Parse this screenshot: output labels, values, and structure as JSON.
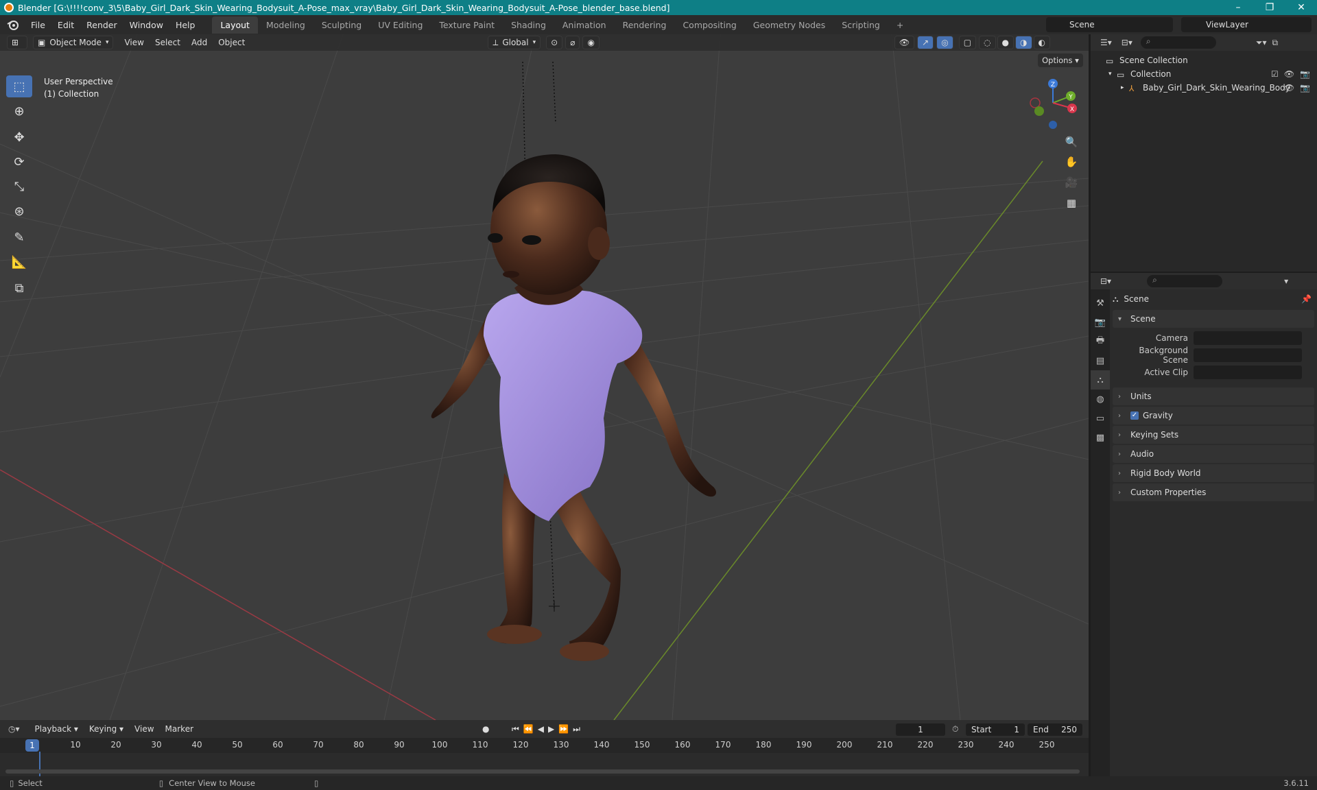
{
  "window": {
    "title": "Blender [G:\\!!!!conv_3\\5\\Baby_Girl_Dark_Skin_Wearing_Bodysuit_A-Pose_max_vray\\Baby_Girl_Dark_Skin_Wearing_Bodysuit_A-Pose_blender_base.blend]"
  },
  "menu": [
    "File",
    "Edit",
    "Render",
    "Window",
    "Help"
  ],
  "workspaces": [
    "Layout",
    "Modeling",
    "Sculpting",
    "UV Editing",
    "Texture Paint",
    "Shading",
    "Animation",
    "Rendering",
    "Compositing",
    "Geometry Nodes",
    "Scripting"
  ],
  "scene_name": "Scene",
  "view_layer": "ViewLayer",
  "viewport": {
    "mode": "Object Mode",
    "menus": [
      "View",
      "Select",
      "Add",
      "Object"
    ],
    "orientation": "Global",
    "options": "Options",
    "info_line1": "User Perspective",
    "info_line2": "(1) Collection",
    "gizmo": {
      "x": "X",
      "y": "Y",
      "z": "Z"
    }
  },
  "outliner": {
    "root": "Scene Collection",
    "collection": "Collection",
    "object": "Baby_Girl_Dark_Skin_Wearing_Body"
  },
  "properties": {
    "context": "Scene",
    "panel_scene": "Scene",
    "camera_label": "Camera",
    "background_label": "Background Scene",
    "clip_label": "Active Clip",
    "panels": [
      "Units",
      "Gravity",
      "Keying Sets",
      "Audio",
      "Rigid Body World",
      "Custom Properties"
    ]
  },
  "timeline": {
    "menus": [
      "Playback",
      "Keying",
      "View",
      "Marker"
    ],
    "current_frame": "1",
    "start_label": "Start",
    "start": "1",
    "end_label": "End",
    "end": "250",
    "ticks": [
      "1",
      "10",
      "20",
      "30",
      "40",
      "50",
      "60",
      "70",
      "80",
      "90",
      "100",
      "110",
      "120",
      "130",
      "140",
      "150",
      "160",
      "170",
      "180",
      "190",
      "200",
      "210",
      "220",
      "230",
      "240",
      "250"
    ]
  },
  "status": {
    "select": "Select",
    "center": "Center View to Mouse",
    "version": "3.6.11"
  }
}
